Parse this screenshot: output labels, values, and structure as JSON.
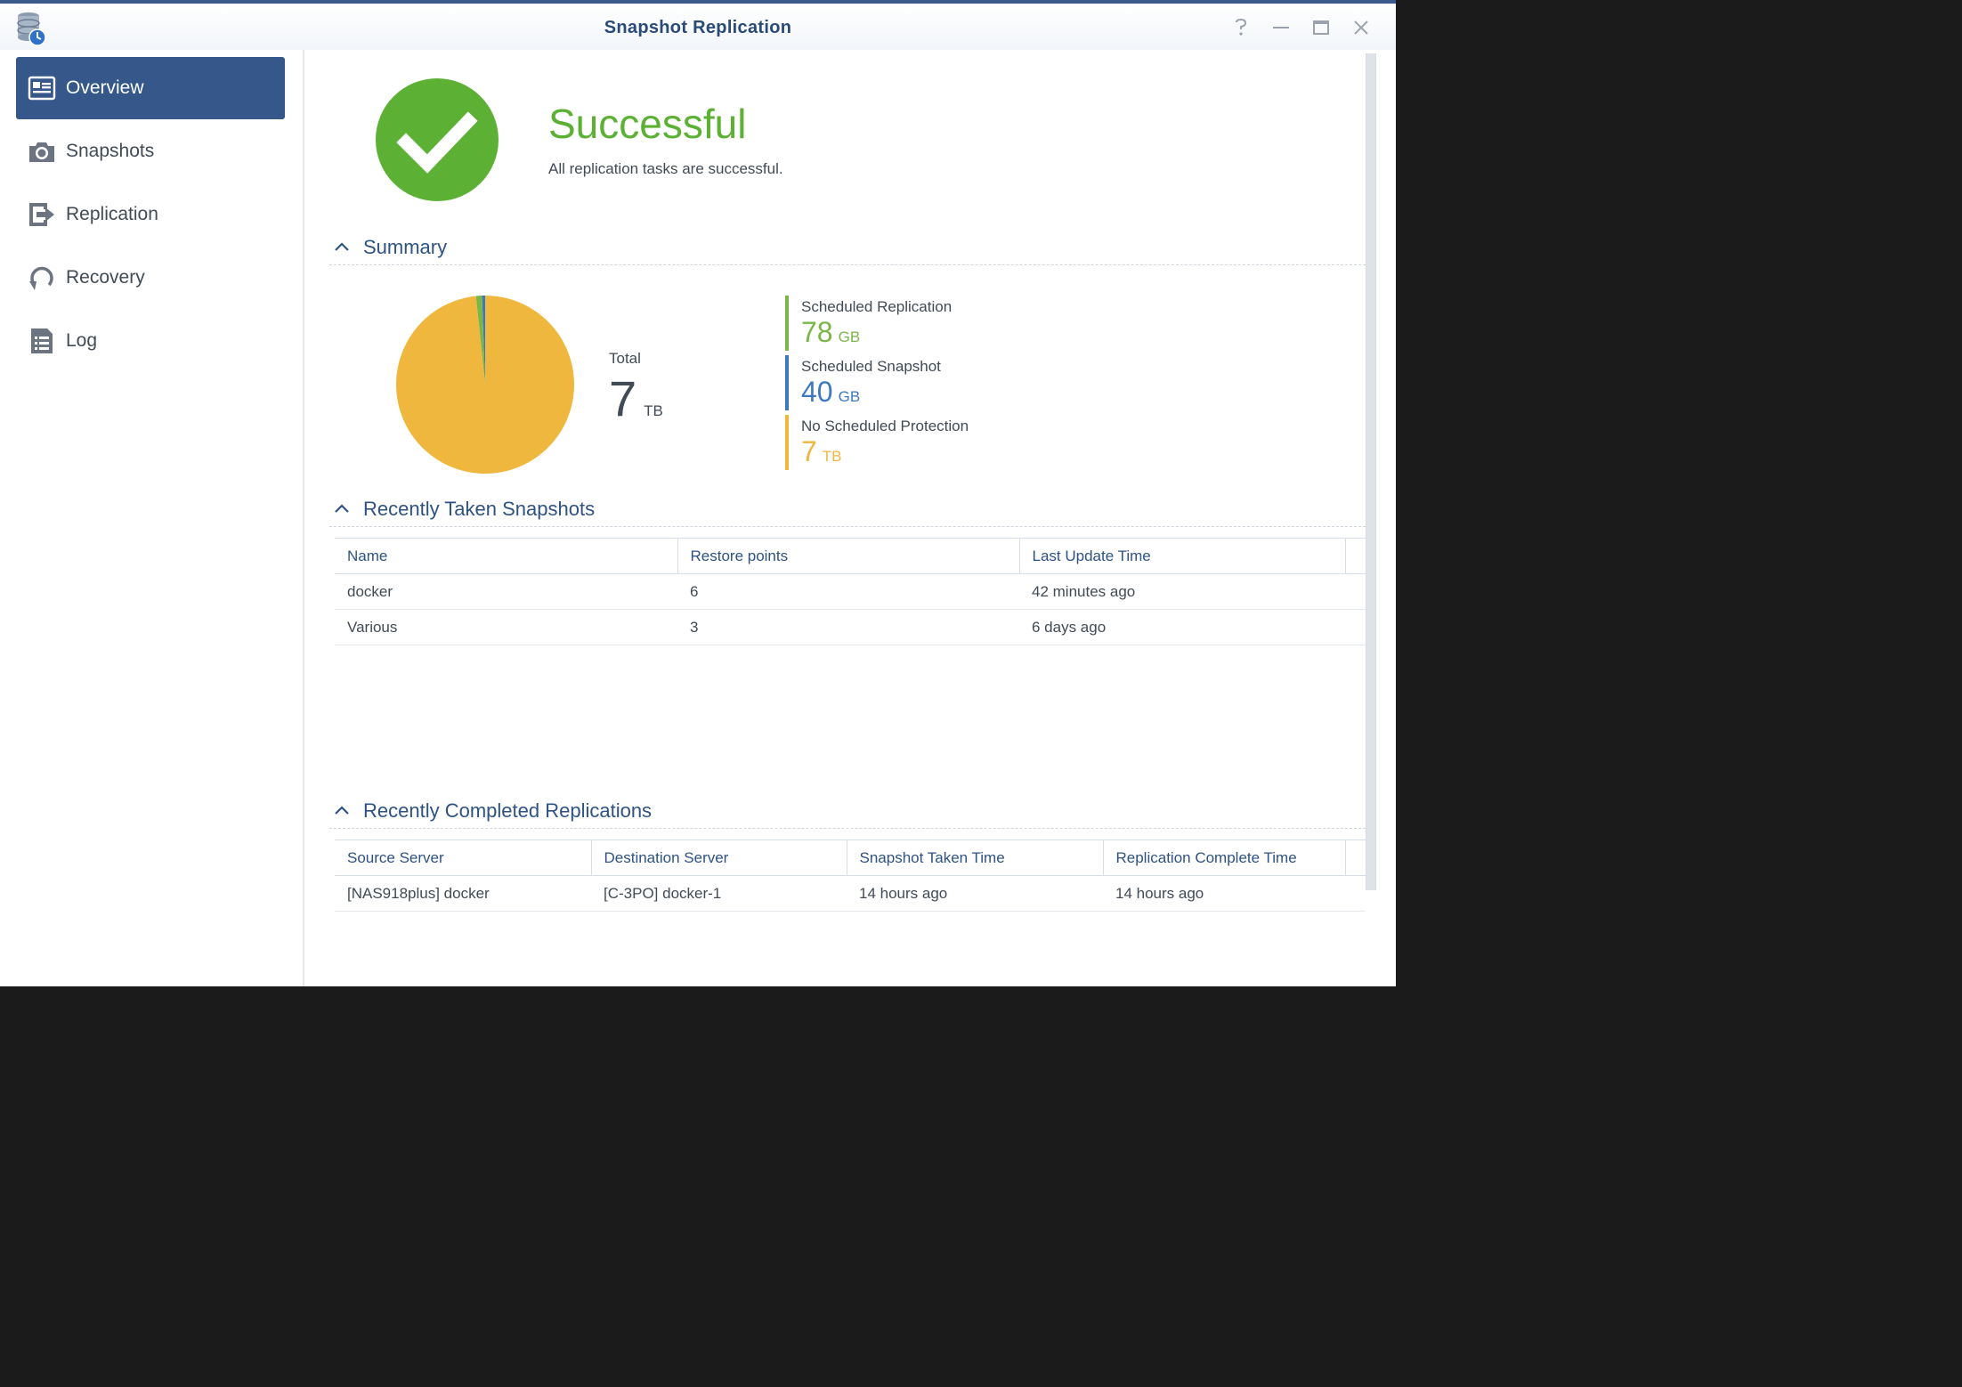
{
  "window": {
    "title": "Snapshot Replication",
    "controls": [
      "help-icon",
      "minimize-icon",
      "maximize-icon",
      "close-icon"
    ]
  },
  "sidebar": {
    "items": [
      {
        "label": "Overview",
        "icon": "overview-card-icon",
        "active": true
      },
      {
        "label": "Snapshots",
        "icon": "camera-icon",
        "active": false
      },
      {
        "label": "Replication",
        "icon": "replication-arrow-icon",
        "active": false
      },
      {
        "label": "Recovery",
        "icon": "recovery-icon",
        "active": false
      },
      {
        "label": "Log",
        "icon": "log-list-icon",
        "active": false
      }
    ]
  },
  "status": {
    "title": "Successful",
    "description": "All replication tasks are successful.",
    "icon": "checkmark-icon",
    "color": "#5cb135"
  },
  "summary": {
    "title": "Summary",
    "total_label": "Total",
    "total_value": "7",
    "total_unit": "TB",
    "items": [
      {
        "label": "Scheduled Replication",
        "value": "78",
        "unit": "GB",
        "color": "#7ab648"
      },
      {
        "label": "Scheduled Snapshot",
        "value": "40",
        "unit": "GB",
        "color": "#3d79c3"
      },
      {
        "label": "No Scheduled Protection",
        "value": "7",
        "unit": "TB",
        "color": "#f0b73f"
      }
    ]
  },
  "chart_data": {
    "type": "pie",
    "slices": [
      {
        "label": "Scheduled Replication",
        "value_gb": 78,
        "color": "#7ab648"
      },
      {
        "label": "Scheduled Snapshot",
        "value_gb": 40,
        "color": "#3d79c3"
      },
      {
        "label": "No Scheduled Protection",
        "value_gb": 7000,
        "color": "#f0b73f"
      }
    ]
  },
  "snapshots": {
    "title": "Recently Taken Snapshots",
    "columns": [
      "Name",
      "Restore points",
      "Last Update Time"
    ],
    "rows": [
      [
        "docker",
        "6",
        "42 minutes ago"
      ],
      [
        "Various",
        "3",
        "6 days ago"
      ]
    ]
  },
  "replications": {
    "title": "Recently Completed Replications",
    "columns": [
      "Source Server",
      "Destination Server",
      "Snapshot Taken Time",
      "Replication Complete Time"
    ],
    "rows": [
      [
        "[NAS918plus] docker",
        "[C-3PO] docker-1",
        "14 hours ago",
        "14 hours ago"
      ]
    ]
  }
}
